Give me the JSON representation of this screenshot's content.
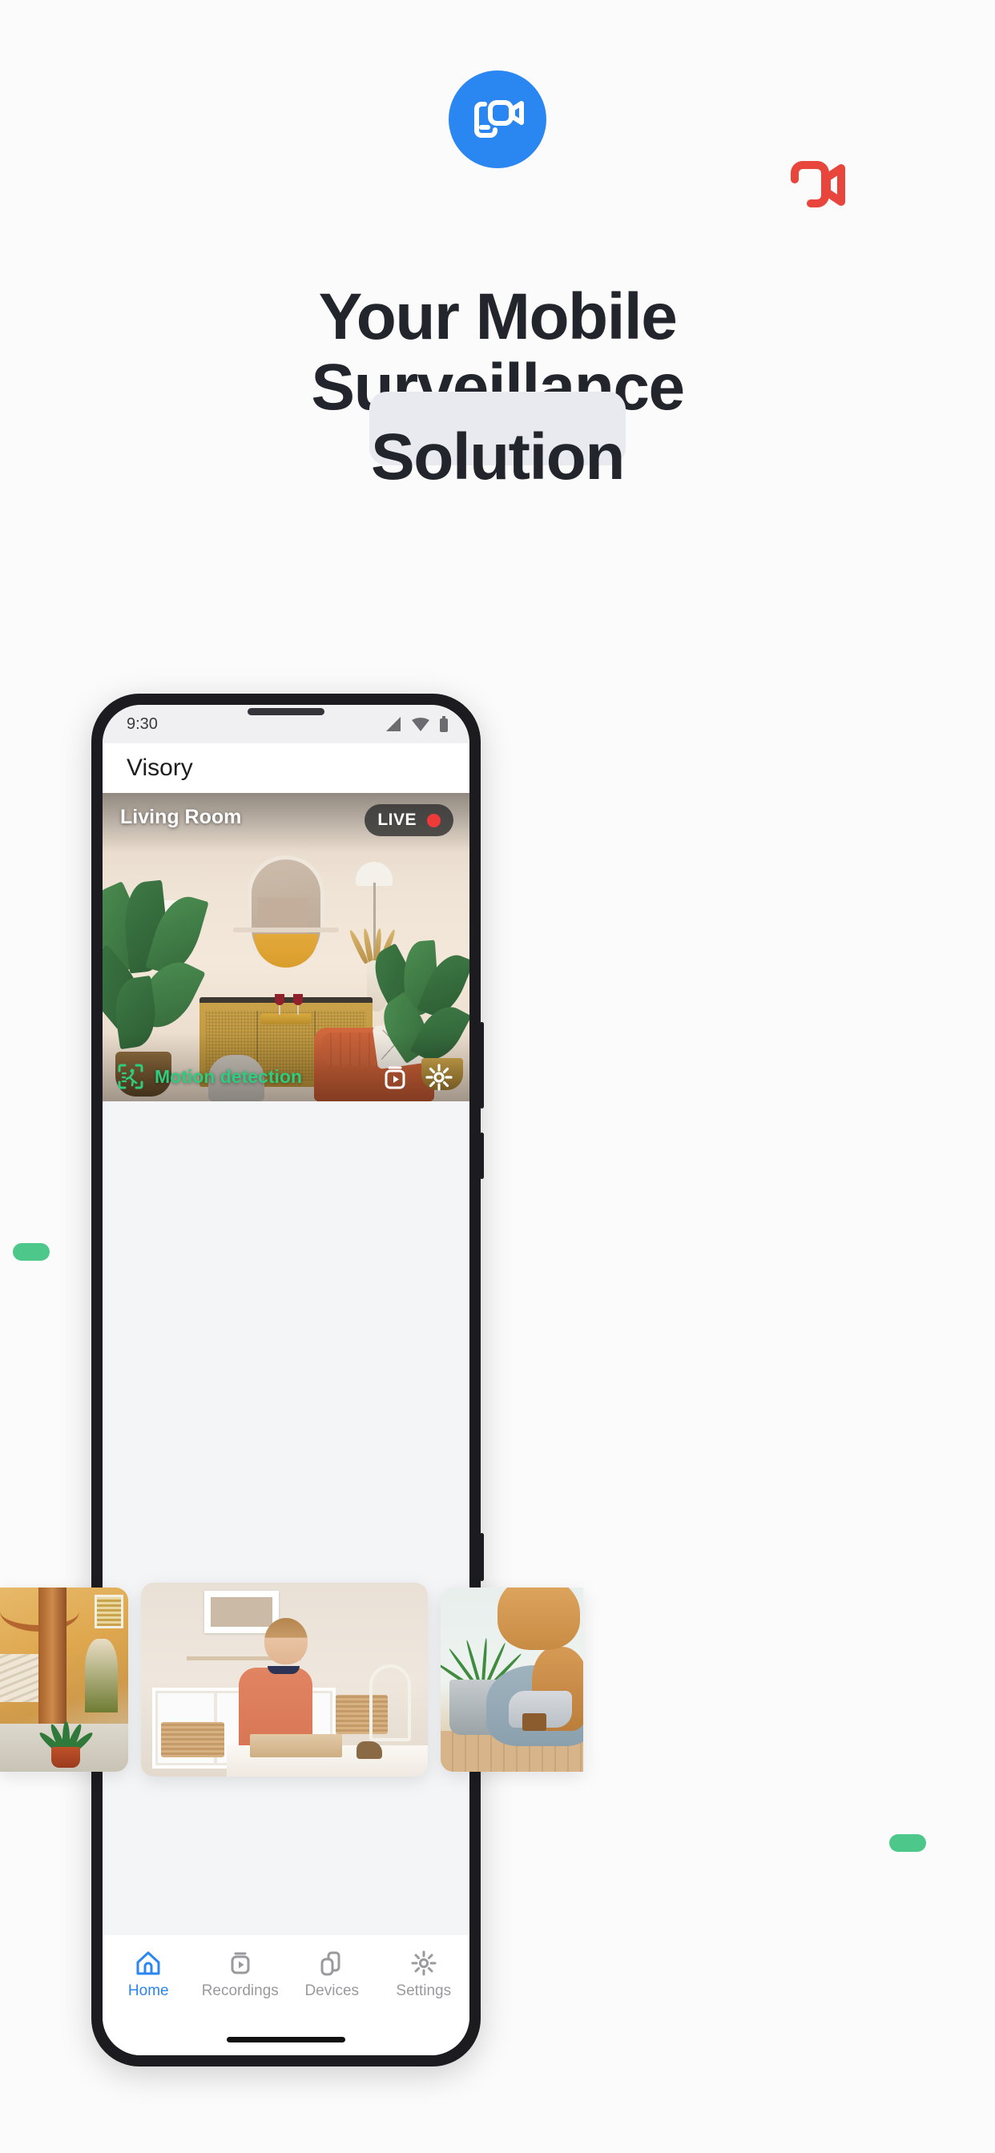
{
  "hero": {
    "logo_icon": "video-camera-logo-icon",
    "logo_color": "#2a86f0",
    "accent_mark_icon": "video-camera-outline-icon",
    "accent_mark_color": "#e8453c",
    "headline_line1": "Your Mobile",
    "headline_line2": "Surveillance",
    "headline_line3": "Solution",
    "highlight_color": "#e8eaf0",
    "decor_pill_color": "#4ec88a"
  },
  "phone": {
    "statusbar": {
      "time": "9:30",
      "signal_icon": "cellular-signal-icon",
      "wifi_icon": "wifi-icon",
      "battery_icon": "battery-icon"
    },
    "appbar": {
      "title": "Visory"
    },
    "camera_feed": {
      "label": "Living Room",
      "live_badge": "LIVE",
      "live_dot_color": "#ef3a3a",
      "motion_label": "Motion detection",
      "motion_color": "#2fcc7e",
      "motion_icon": "motion-detection-scan-icon",
      "record_icon": "recordings-icon",
      "settings_icon": "gear-icon",
      "scene_description": "Living room with tall tropical plants, arched mirror, gold sideboard, orange sofa"
    },
    "thumbnails": [
      {
        "name": "courtyard-thumbnail",
        "description": "Mediterranean courtyard with arches, stairs and potted plants"
      },
      {
        "name": "playroom-thumbnail",
        "description": "Child in coral shirt playing with toys at a white table"
      },
      {
        "name": "pet-thumbnail",
        "description": "Golden retriever lying on a blue-grey bean bag next to a potted palm"
      }
    ],
    "bottom_nav": [
      {
        "label": "Home",
        "icon": "home-icon",
        "active": true
      },
      {
        "label": "Recordings",
        "icon": "recordings-icon",
        "active": false
      },
      {
        "label": "Devices",
        "icon": "devices-icon",
        "active": false
      },
      {
        "label": "Settings",
        "icon": "gear-icon",
        "active": false
      }
    ],
    "nav_active_color": "#2a86f0",
    "nav_inactive_color": "#9a9a9e"
  }
}
